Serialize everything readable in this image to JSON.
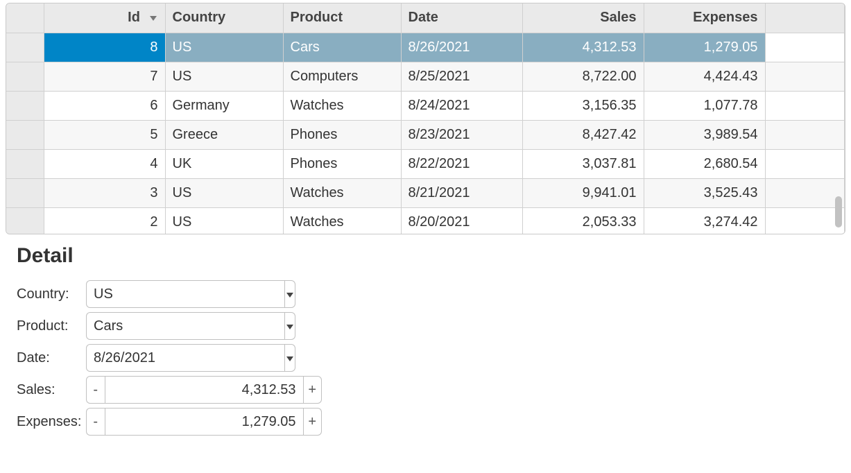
{
  "grid": {
    "columns": {
      "id": "Id",
      "country": "Country",
      "product": "Product",
      "date": "Date",
      "sales": "Sales",
      "expenses": "Expenses"
    },
    "sort": {
      "column": "id",
      "direction": "desc"
    },
    "rows": [
      {
        "id": "8",
        "country": "US",
        "product": "Cars",
        "date": "8/26/2021",
        "sales": "4,312.53",
        "expenses": "1,279.05",
        "selected": true
      },
      {
        "id": "7",
        "country": "US",
        "product": "Computers",
        "date": "8/25/2021",
        "sales": "8,722.00",
        "expenses": "4,424.43"
      },
      {
        "id": "6",
        "country": "Germany",
        "product": "Watches",
        "date": "8/24/2021",
        "sales": "3,156.35",
        "expenses": "1,077.78"
      },
      {
        "id": "5",
        "country": "Greece",
        "product": "Phones",
        "date": "8/23/2021",
        "sales": "8,427.42",
        "expenses": "3,989.54"
      },
      {
        "id": "4",
        "country": "UK",
        "product": "Phones",
        "date": "8/22/2021",
        "sales": "3,037.81",
        "expenses": "2,680.54"
      },
      {
        "id": "3",
        "country": "US",
        "product": "Watches",
        "date": "8/21/2021",
        "sales": "9,941.01",
        "expenses": "3,525.43"
      },
      {
        "id": "2",
        "country": "US",
        "product": "Watches",
        "date": "8/20/2021",
        "sales": "2,053.33",
        "expenses": "3,274.42"
      }
    ]
  },
  "detail": {
    "title": "Detail",
    "labels": {
      "country": "Country:",
      "product": "Product:",
      "date": "Date:",
      "sales": "Sales:",
      "expenses": "Expenses:"
    },
    "values": {
      "country": "US",
      "product": "Cars",
      "date": "8/26/2021",
      "sales": "4,312.53",
      "expenses": "1,279.05"
    },
    "buttons": {
      "minus": "-",
      "plus": "+"
    }
  }
}
